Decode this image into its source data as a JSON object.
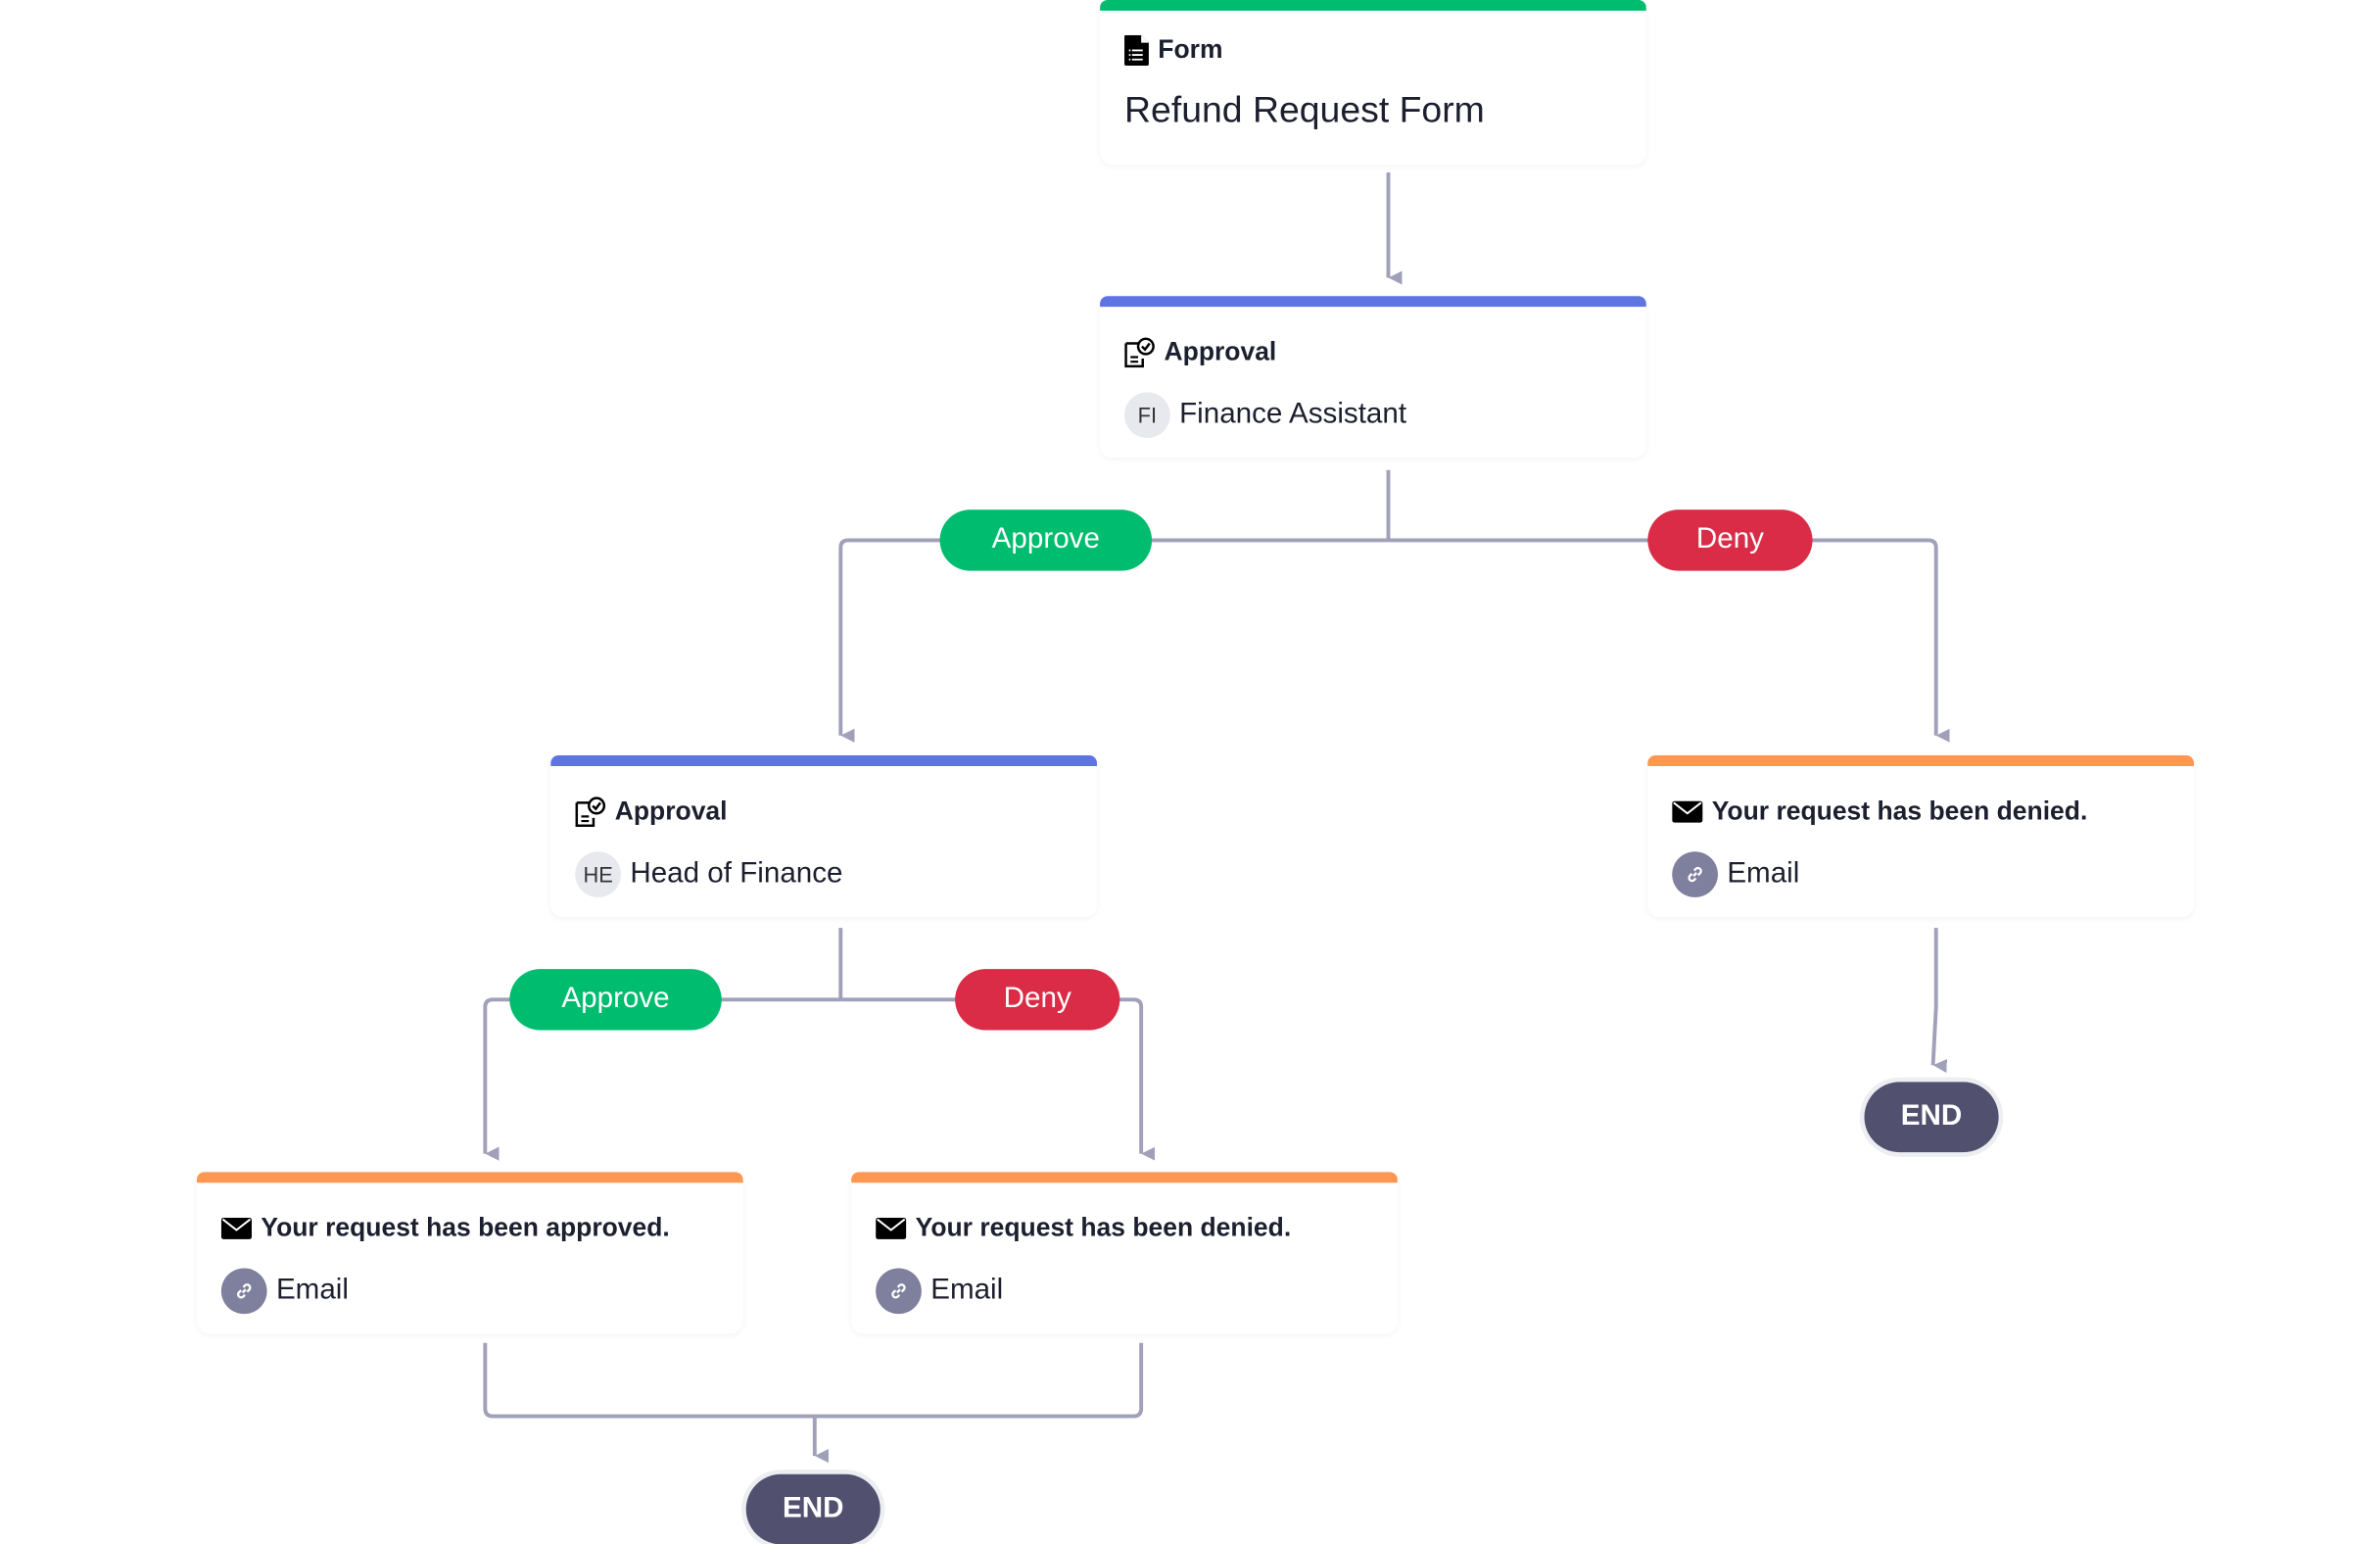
{
  "colors": {
    "form": "#00BC6E",
    "approval": "#5F74E3",
    "email": "#FF9652",
    "approve": "#00BC6E",
    "deny": "#DA2C47",
    "end": "#52506F",
    "connector": "#A0A0BA"
  },
  "form": {
    "type": "Form",
    "title": "Refund Request Form",
    "icon": "form-document-icon"
  },
  "approval1": {
    "type": "Approval",
    "avatar": "FI",
    "assignee": "Finance Assistant"
  },
  "approval2": {
    "type": "Approval",
    "avatar": "HE",
    "assignee": "Head of Finance"
  },
  "branches": {
    "approve": "Approve",
    "deny": "Deny"
  },
  "email_denied_right": {
    "subject": "Your request has been denied.",
    "channel": "Email"
  },
  "email_approved": {
    "subject": "Your request has been approved.",
    "channel": "Email"
  },
  "email_denied_left": {
    "subject": "Your request has been denied.",
    "channel": "Email"
  },
  "end_label": "END"
}
